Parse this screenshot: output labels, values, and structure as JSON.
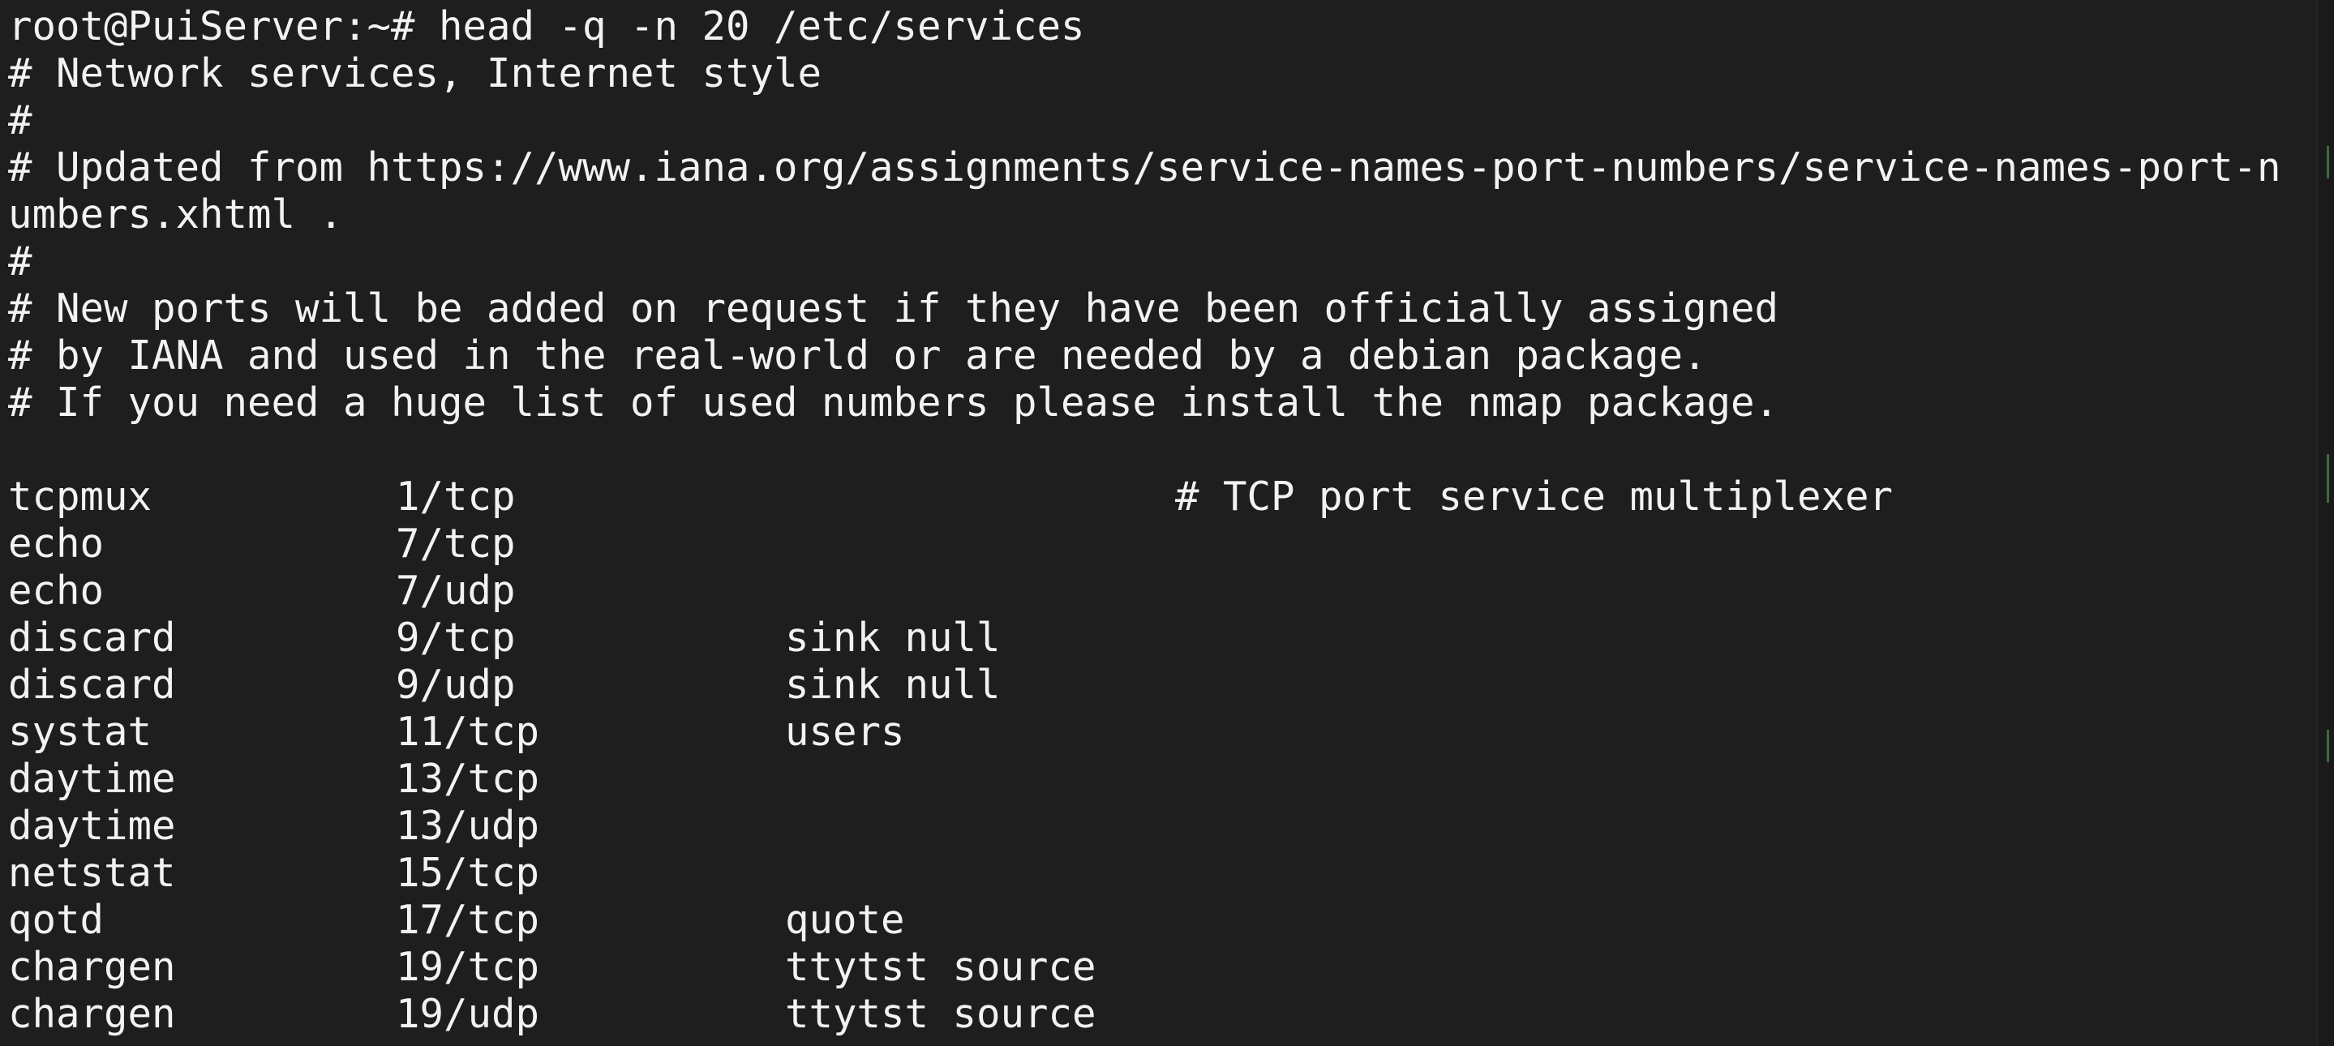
{
  "terminal": {
    "prompt_line": "root@PuiServer:~# head -q -n 20 /etc/services",
    "header_lines": [
      "# Network services, Internet style",
      "#",
      "# Updated from https://www.iana.org/assignments/service-names-port-numbers/service-names-port-n",
      "umbers.xhtml .",
      "#",
      "# New ports will be added on request if they have been officially assigned",
      "# by IANA and used in the real-world or are needed by a debian package.",
      "# If you need a huge list of used numbers please install the nmap package."
    ],
    "services": [
      {
        "name": "tcpmux",
        "port": "1/tcp",
        "alias": "",
        "comment": "# TCP port service multiplexer"
      },
      {
        "name": "echo",
        "port": "7/tcp",
        "alias": "",
        "comment": ""
      },
      {
        "name": "echo",
        "port": "7/udp",
        "alias": "",
        "comment": ""
      },
      {
        "name": "discard",
        "port": "9/tcp",
        "alias": "sink null",
        "comment": ""
      },
      {
        "name": "discard",
        "port": "9/udp",
        "alias": "sink null",
        "comment": ""
      },
      {
        "name": "systat",
        "port": "11/tcp",
        "alias": "users",
        "comment": ""
      },
      {
        "name": "daytime",
        "port": "13/tcp",
        "alias": "",
        "comment": ""
      },
      {
        "name": "daytime",
        "port": "13/udp",
        "alias": "",
        "comment": ""
      },
      {
        "name": "netstat",
        "port": "15/tcp",
        "alias": "",
        "comment": ""
      },
      {
        "name": "qotd",
        "port": "17/tcp",
        "alias": "quote",
        "comment": ""
      },
      {
        "name": "chargen",
        "port": "19/tcp",
        "alias": "ttytst source",
        "comment": ""
      },
      {
        "name": "chargen",
        "port": "19/udp",
        "alias": "ttytst source",
        "comment": ""
      }
    ],
    "colors": {
      "background": "#1e1e1e",
      "foreground": "#f2f2f2"
    }
  }
}
